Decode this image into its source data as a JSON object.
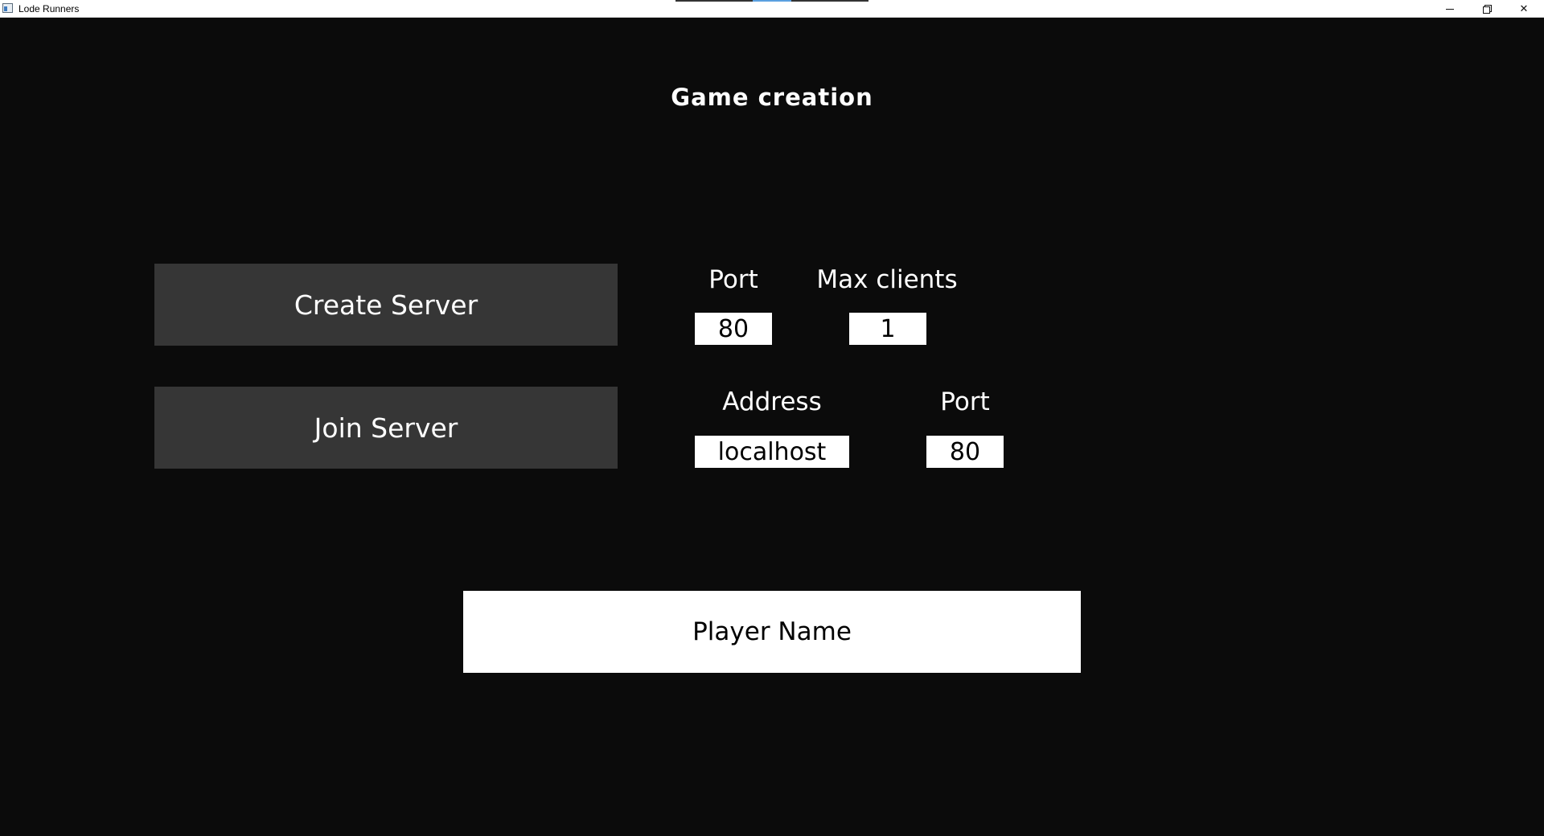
{
  "window": {
    "title": "Lode Runners",
    "controls": {
      "minimize": "minimize",
      "restore": "restore",
      "close": "✕"
    }
  },
  "screen": {
    "heading": "Game creation"
  },
  "create_server": {
    "button_label": "Create Server",
    "port_label": "Port",
    "port_value": "80",
    "max_clients_label": "Max clients",
    "max_clients_value": "1"
  },
  "join_server": {
    "button_label": "Join Server",
    "address_label": "Address",
    "address_value": "localhost",
    "port_label": "Port",
    "port_value": "80"
  },
  "player": {
    "name_placeholder": "Player Name"
  },
  "colors": {
    "background": "#0b0b0b",
    "button": "#363636",
    "text": "#ffffff",
    "input_background": "#ffffff"
  },
  "icons": {
    "app": "app-window-icon",
    "minimize": "minimize-icon",
    "restore": "restore-icon",
    "close": "close-icon"
  }
}
